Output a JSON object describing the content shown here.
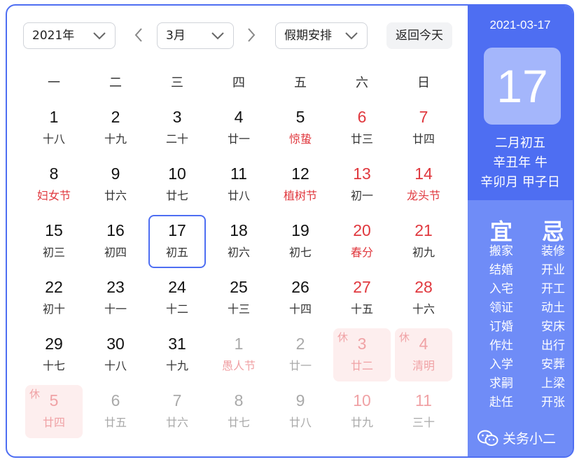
{
  "controls": {
    "year": "2021年",
    "month": "3月",
    "holiday_select": "假期安排",
    "today_button": "返回今天"
  },
  "weekdays": [
    "一",
    "二",
    "三",
    "四",
    "五",
    "六",
    "日"
  ],
  "days": [
    {
      "num": "1",
      "lunar": "十八"
    },
    {
      "num": "2",
      "lunar": "十九"
    },
    {
      "num": "3",
      "lunar": "二十"
    },
    {
      "num": "4",
      "lunar": "廿一"
    },
    {
      "num": "5",
      "lunar": "惊蛰",
      "fest": true
    },
    {
      "num": "6",
      "lunar": "廿三",
      "weekend": true
    },
    {
      "num": "7",
      "lunar": "廿四",
      "weekend": true
    },
    {
      "num": "8",
      "lunar": "妇女节",
      "fest": true
    },
    {
      "num": "9",
      "lunar": "廿六"
    },
    {
      "num": "10",
      "lunar": "廿七"
    },
    {
      "num": "11",
      "lunar": "廿八"
    },
    {
      "num": "12",
      "lunar": "植树节",
      "fest": true
    },
    {
      "num": "13",
      "lunar": "初一",
      "weekend": true
    },
    {
      "num": "14",
      "lunar": "龙头节",
      "weekend": true,
      "fest": true
    },
    {
      "num": "15",
      "lunar": "初三"
    },
    {
      "num": "16",
      "lunar": "初四"
    },
    {
      "num": "17",
      "lunar": "初五",
      "selected": true
    },
    {
      "num": "18",
      "lunar": "初六"
    },
    {
      "num": "19",
      "lunar": "初七"
    },
    {
      "num": "20",
      "lunar": "春分",
      "weekend": true,
      "fest": true
    },
    {
      "num": "21",
      "lunar": "初九",
      "weekend": true
    },
    {
      "num": "22",
      "lunar": "初十"
    },
    {
      "num": "23",
      "lunar": "十一"
    },
    {
      "num": "24",
      "lunar": "十二"
    },
    {
      "num": "25",
      "lunar": "十三"
    },
    {
      "num": "26",
      "lunar": "十四"
    },
    {
      "num": "27",
      "lunar": "十五",
      "weekend": true
    },
    {
      "num": "28",
      "lunar": "十六",
      "weekend": true
    },
    {
      "num": "29",
      "lunar": "十七"
    },
    {
      "num": "30",
      "lunar": "十八"
    },
    {
      "num": "31",
      "lunar": "十九"
    },
    {
      "num": "1",
      "lunar": "愚人节",
      "other": true,
      "fest": true
    },
    {
      "num": "2",
      "lunar": "廿一",
      "other": true
    },
    {
      "num": "3",
      "lunar": "廿二",
      "other": true,
      "weekend": true,
      "holiday": true,
      "rest": "休"
    },
    {
      "num": "4",
      "lunar": "清明",
      "other": true,
      "weekend": true,
      "holiday": true,
      "rest": "休"
    },
    {
      "num": "5",
      "lunar": "廿四",
      "other": true,
      "holiday": true,
      "rest": "休"
    },
    {
      "num": "6",
      "lunar": "廿五",
      "other": true
    },
    {
      "num": "7",
      "lunar": "廿六",
      "other": true
    },
    {
      "num": "8",
      "lunar": "廿七",
      "other": true
    },
    {
      "num": "9",
      "lunar": "廿八",
      "other": true
    },
    {
      "num": "10",
      "lunar": "廿九",
      "other": true,
      "weekend": true
    },
    {
      "num": "11",
      "lunar": "三十",
      "other": true,
      "weekend": true
    }
  ],
  "panel": {
    "date": "2021-03-17",
    "day": "17",
    "lunar_date": "二月初五",
    "year_ganzhi": "辛丑年 牛",
    "month_day_ganzhi": "辛卯月 甲子日",
    "yi_title": "宜",
    "ji_title": "忌",
    "yi": [
      "搬家",
      "结婚",
      "入宅",
      "领证",
      "订婚",
      "作灶",
      "入学",
      "求嗣",
      "赴任"
    ],
    "ji": [
      "装修",
      "开业",
      "开工",
      "动土",
      "安床",
      "出行",
      "安葬",
      "上梁",
      "开张"
    ],
    "footer": "关务小二"
  },
  "colors": {
    "accent": "#4e6ef2",
    "weekend": "#e0383e",
    "holiday_bg": "#fdeeee"
  }
}
